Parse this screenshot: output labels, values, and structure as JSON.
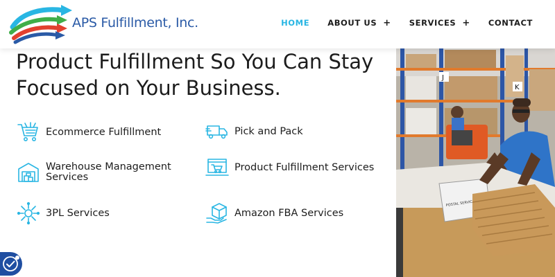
{
  "brand": {
    "name": "APS Fulfillment, Inc.",
    "colors": {
      "primary": "#2a5aa6",
      "accent": "#29b6e3",
      "arrow_red": "#e2402f",
      "arrow_green": "#3fae49"
    }
  },
  "nav": {
    "items": [
      {
        "label": "HOME",
        "active": true,
        "has_submenu": false
      },
      {
        "label": "ABOUT US",
        "active": false,
        "has_submenu": true
      },
      {
        "label": "SERVICES",
        "active": false,
        "has_submenu": true
      },
      {
        "label": "CONTACT",
        "active": false,
        "has_submenu": false
      }
    ],
    "submenu_indicator": "+"
  },
  "hero": {
    "headline_line1": "Product Fulfillment So You Can Stay",
    "headline_line2": "Focused on Your Business."
  },
  "services": [
    {
      "label": "Ecommerce Fulfillment",
      "icon": "shopping-cart-icon"
    },
    {
      "label": "Pick and Pack",
      "icon": "delivery-truck-icon"
    },
    {
      "label": "Warehouse Management Services",
      "icon": "warehouse-icon"
    },
    {
      "label": "Product Fulfillment Services",
      "icon": "laptop-cart-icon"
    },
    {
      "label": "3PL Services",
      "icon": "network-hub-icon"
    },
    {
      "label": "Amazon FBA Services",
      "icon": "package-hand-icon"
    }
  ],
  "photo": {
    "subject": "warehouse-worker-packing-boxes"
  },
  "accessibility": {
    "icon": "accessibility-icon",
    "color": "#1f4ea1"
  }
}
